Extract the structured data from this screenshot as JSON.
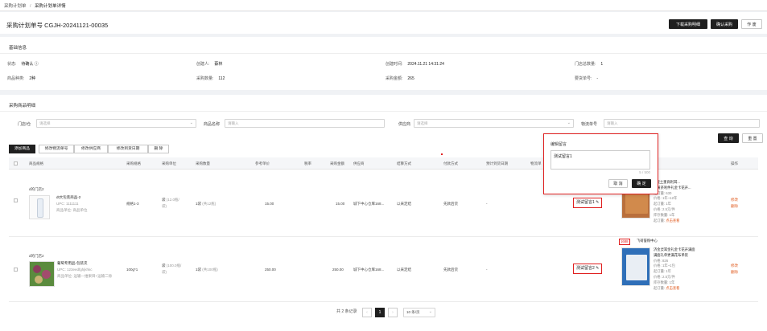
{
  "breadcrumb": {
    "parent": "采购计划单",
    "sep": "/",
    "current": "采购计划单详情"
  },
  "header": {
    "title": "采购计划单号 CGJH-20241121-00035",
    "btn_download": "下载采购明细",
    "btn_confirm": "确认采购",
    "btn_void": "作 废"
  },
  "basic": {
    "title": "基础信息",
    "status_label": "状态:",
    "status_value": "待确认 ⓘ",
    "creator_label": "创建人:",
    "creator_value": "蔡林",
    "created_label": "创建时间:",
    "created_value": "2024.11.21 14:31:24",
    "stores_label": "门店总数量:",
    "stores_value": "1",
    "kinds_label": "商品种类:",
    "kinds_value": "2种",
    "qty_label": "采购数量:",
    "qty_value": "112",
    "amount_label": "采购金额:",
    "amount_value": "265",
    "ship_label": "要货单号:",
    "ship_value": "-"
  },
  "detail": {
    "title": "采购商品明细",
    "f_store": "门店/仓",
    "f_store_ph": "请选择",
    "f_name": "商品名称",
    "f_name_ph": "请输入",
    "f_supplier": "供应商",
    "f_supplier_ph": "请选择",
    "f_track": "物流单号",
    "f_track_ph": "请输入",
    "btn_query": "查 询",
    "btn_reset": "重 置"
  },
  "tabs": [
    "添加商品",
    "修改物流单号",
    "修改供应商",
    "修改到货日期",
    "删 除"
  ],
  "columns": [
    "商品规格",
    "采购规格",
    "采购单位",
    "采购数量",
    "参考单价",
    "税率",
    "采购金额",
    "供应商",
    "结算方式",
    "付款方式",
    "预计到货日期",
    "物流单",
    "操作"
  ],
  "rows": [
    {
      "store": "d的门店2",
      "name": "dt大包装商品-2",
      "upc": "UPC: 1111111",
      "sub": "商品单位: 商品单位",
      "spec": "规格1-3",
      "unit1": "袋",
      "unit2": "(12.0瓶/",
      "unit3": "袋)",
      "qty": "1袋",
      "qty_sub": "(共12瓶)",
      "price": "15.00",
      "amount": "15.00",
      "supplier": "城下中心仓库168...",
      "settle": "以采定结",
      "pay": "先款后货",
      "eta": "-",
      "remark": "测试留言1 ✎",
      "ops": [
        "修改",
        "删除"
      ]
    },
    {
      "store": "d的门店2",
      "name": "葡萄专用品-包装次",
      "upc": "UPC: 123eedfghjkhkc",
      "sub": "商品单位: 运输—维果目+运输二除",
      "spec": "100g*1",
      "unit1": "袋",
      "unit2": "(100.0瓶/",
      "unit3": "袋)",
      "qty": "1袋",
      "qty_sub": "(共100瓶)",
      "price": "250.00",
      "amount": "250.00",
      "supplier": "城下中心仓库168...",
      "settle": "以采定结",
      "pay": "先款后货",
      "eta": "-",
      "remark": "测试留言2 ✎",
      "ops": [
        "修改",
        "删除"
      ]
    }
  ],
  "popover": {
    "title": "编辑留言",
    "text": "测试留言1",
    "count": "5 / 500",
    "cancel": "取 消",
    "ok": "确 定"
  },
  "ad1": {
    "l1": "...瓷土重商利耳...",
    "l2": "浆黄茶利件礼金卡花开...",
    "l3": "起订量: 630",
    "l4": "价格: 1年~12年",
    "l5": "起订量: 1年",
    "l6": "价格: 2.5元/件",
    "l7": "库存数量: 1年",
    "l8": "起订量:",
    "l9": "点击查看"
  },
  "ad2": {
    "badge": "1688",
    "shop": "飞荷誉购中心",
    "l1": "济金灵耳金礼金卡花开满面",
    "l2": "满面礼单更满花布单装",
    "l3": "价格: 826",
    "l4": "价格: 1年~1包",
    "l5": "起订量: 1年",
    "l6": "价格: 2.5元/件",
    "l7": "库存数量: 1年",
    "l8": "起订量:",
    "l9": "点击查看"
  },
  "pagination": {
    "total": "共 2 条记录",
    "page": "1",
    "size": "10 条/页"
  }
}
